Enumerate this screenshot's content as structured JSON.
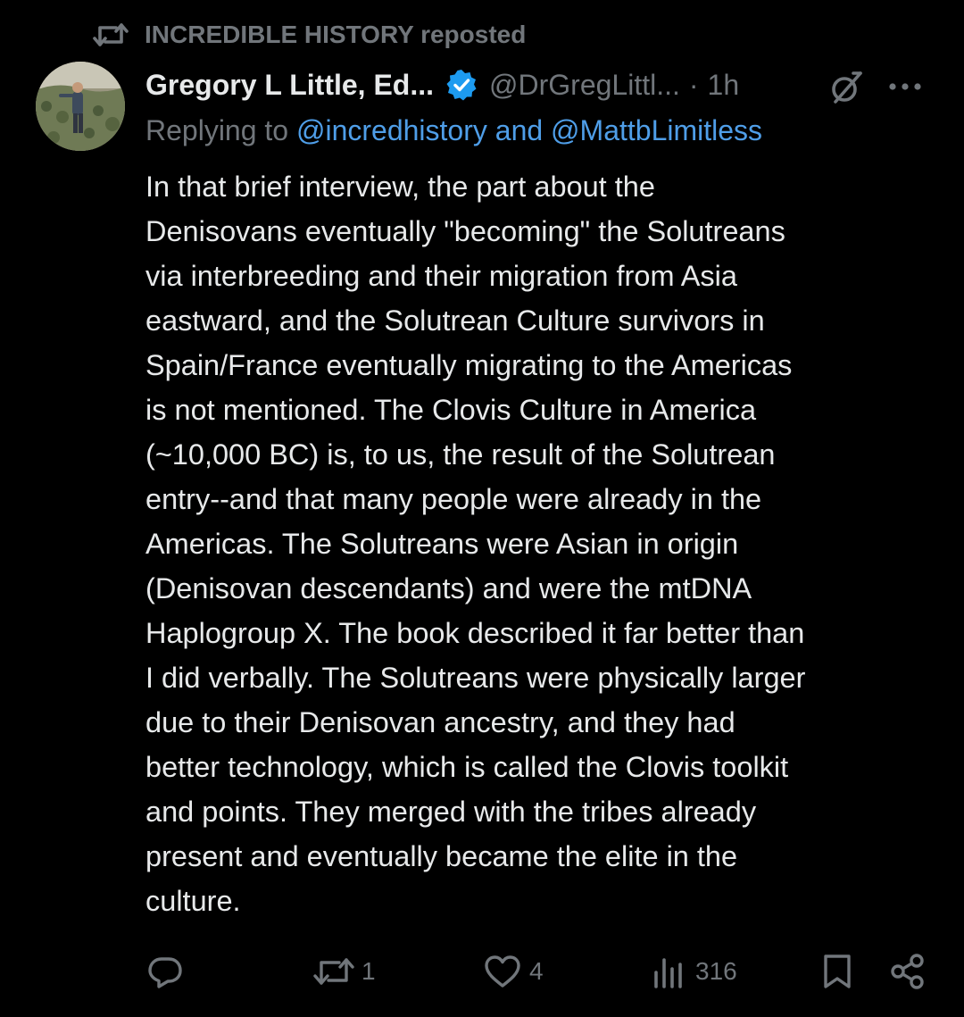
{
  "repost": {
    "label": "INCREDIBLE HISTORY reposted",
    "icon": "repost-icon"
  },
  "post": {
    "author_name": "Gregory L Little, Ed...",
    "handle": "@DrGregLittl...",
    "separator": "·",
    "time": "1h",
    "replying_prefix": "Replying to ",
    "replying_to_1": "@incredhistory",
    "replying_joiner": " and ",
    "replying_to_2": "@MattbLimitless",
    "body": "In that brief interview, the part about the\nDenisovans eventually \"becoming\" the Solutreans\nvia interbreeding and their migration from Asia\neastward, and the Solutrean Culture survivors in\nSpain/France eventually migrating to the Americas\nis not mentioned. The Clovis Culture in America\n(~10,000 BC) is, to us, the result of the Solutrean\nentry--and that many people were already in the\nAmericas. The Solutreans were Asian in origin\n(Denisovan descendants) and were the mtDNA\nHaplogroup X. The book described it far better than\nI did verbally. The Solutreans were physically larger\ndue to their Denisovan ancestry, and they had\nbetter technology, which is called the Clovis toolkit\nand points. They merged with the tribes already\npresent and eventually became the elite in the\nculture."
  },
  "actions": {
    "reply_count": "",
    "repost_count": "1",
    "like_count": "4",
    "views_count": "316"
  },
  "icons": [
    "repost-icon",
    "verified-icon",
    "grok-icon",
    "more-icon",
    "reply-icon",
    "like-icon",
    "views-icon",
    "bookmark-icon",
    "share-icon"
  ],
  "colors": {
    "background": "#000000",
    "text": "#e7e9ea",
    "muted": "#71767b",
    "link": "#4f9ee8",
    "verified": "#1d9bf0"
  }
}
